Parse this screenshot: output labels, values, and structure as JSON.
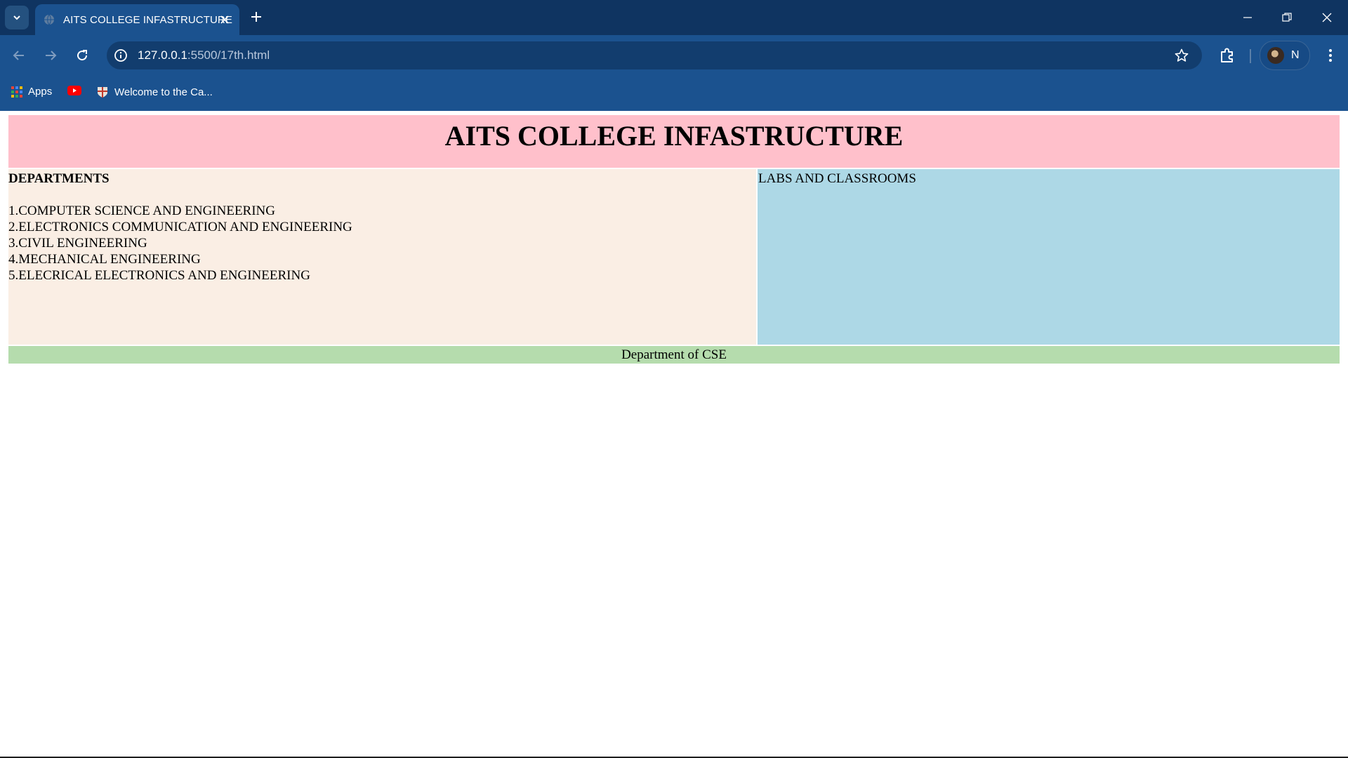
{
  "browser": {
    "tab": {
      "title": "AITS COLLEGE INFASTRUCTURE"
    },
    "address_bar": {
      "url_host": "127.0.0.1",
      "url_rest": ":5500/17th.html"
    },
    "profile": {
      "initial": "N"
    },
    "bookmarks": [
      {
        "label": "Apps"
      },
      {
        "label": ""
      },
      {
        "label": "Welcome to the Ca..."
      }
    ]
  },
  "page": {
    "header": "AITS COLLEGE INFASTRUCTURE",
    "departments": {
      "heading": "DEPARTMENTS",
      "items": [
        "1.COMPUTER SCIENCE AND ENGINEERING",
        "2.ELECTRONICS COMMUNICATION AND ENGINEERING",
        "3.CIVIL ENGINEERING",
        "4.MECHANICAL ENGINEERING",
        "5.ELECRICAL ELECTRONICS AND ENGINEERING"
      ]
    },
    "labs": {
      "heading": "LABS AND CLASSROOMS"
    },
    "footer": "Department of CSE"
  },
  "colors": {
    "header_bg": "#ffc0cb",
    "departments_bg": "#faeee4",
    "labs_bg": "#add8e6",
    "footer_bg": "#b5dcad"
  }
}
